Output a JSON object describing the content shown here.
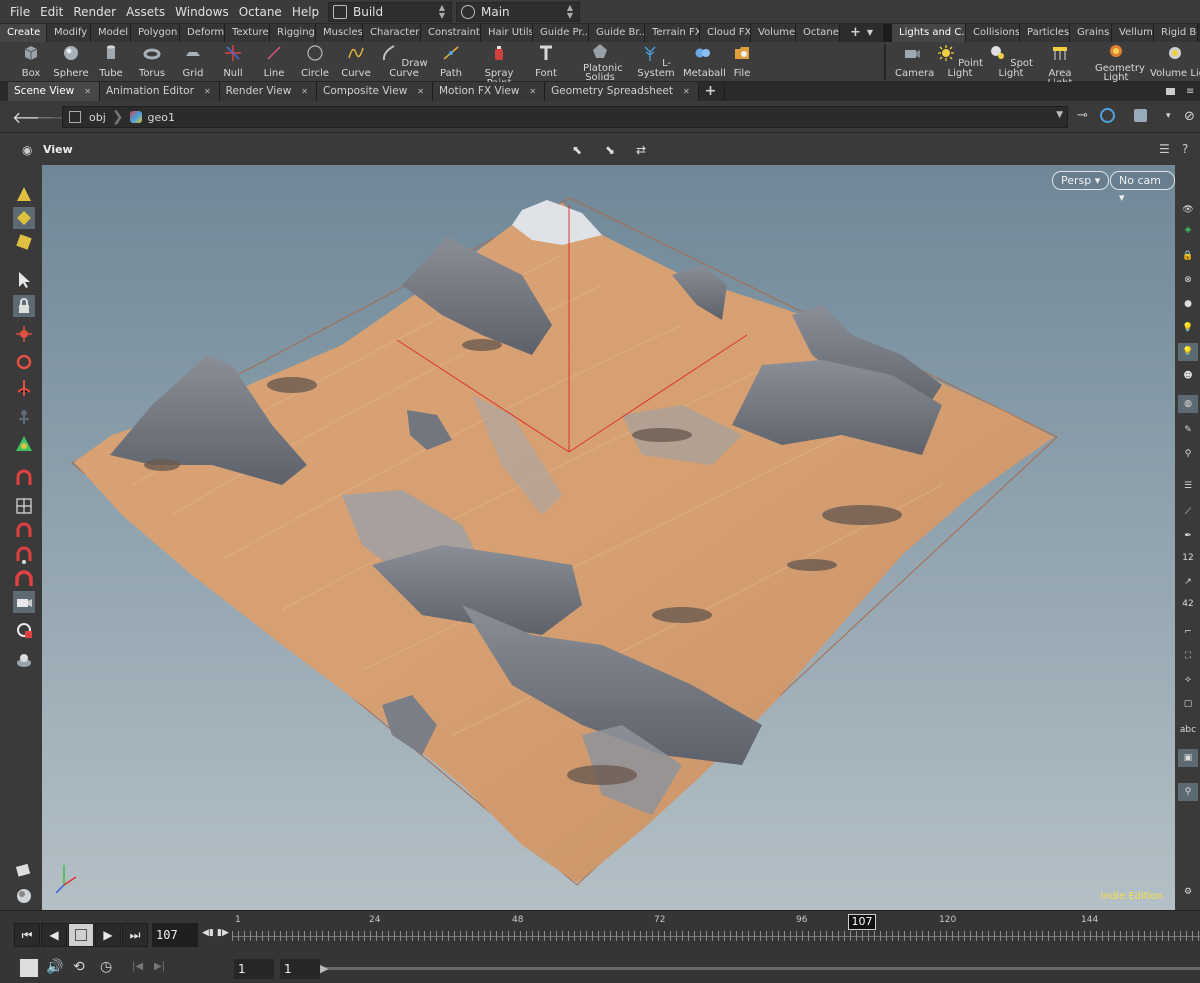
{
  "menubar": {
    "items": [
      "File",
      "Edit",
      "Render",
      "Assets",
      "Windows",
      "Octane",
      "Help"
    ],
    "desktop": "Build",
    "context": "Main"
  },
  "shelf_tabs": [
    "Create",
    "Modify",
    "Model",
    "Polygon",
    "Deform",
    "Texture",
    "Rigging",
    "Muscles",
    "Characters",
    "Constraints",
    "Hair Utils",
    "Guide Pr...",
    "Guide Br...",
    "Terrain FX",
    "Cloud FX",
    "Volume",
    "Octane"
  ],
  "shelf_tabs_right": [
    "Lights and C...",
    "Collisions",
    "Particles",
    "Grains",
    "Vellum",
    "Rigid Bodie"
  ],
  "tools": [
    "Box",
    "Sphere",
    "Tube",
    "Torus",
    "Grid",
    "Null",
    "Line",
    "Circle",
    "Curve",
    "Draw Curve",
    "Path",
    "Spray Paint",
    "Font",
    "Platonic Solids",
    "L-System",
    "Metaball",
    "File"
  ],
  "tools_right": [
    "Camera",
    "Point Light",
    "Spot Light",
    "Area Light",
    "Geometry Light",
    "Volume Light"
  ],
  "pane_tabs": [
    "Scene View",
    "Animation Editor",
    "Render View",
    "Composite View",
    "Motion FX View",
    "Geometry Spreadsheet"
  ],
  "path": {
    "root": "obj",
    "node": "geo1"
  },
  "view": {
    "label": "View",
    "persp": "Persp",
    "cam": "No cam",
    "watermark": "Indie Edition",
    "right_labels": {
      "twelve": "12",
      "fortytwo": "42",
      "abc": "abc"
    }
  },
  "timeline": {
    "current_frame": "107",
    "ticks": [
      "1",
      "24",
      "48",
      "72",
      "96",
      "120",
      "144"
    ],
    "marker": "107",
    "range_start": "1",
    "range_step": "1"
  },
  "colors": {
    "accent": "#4aa3e0",
    "watermark": "#f4e24a",
    "axis": "#e03030"
  }
}
